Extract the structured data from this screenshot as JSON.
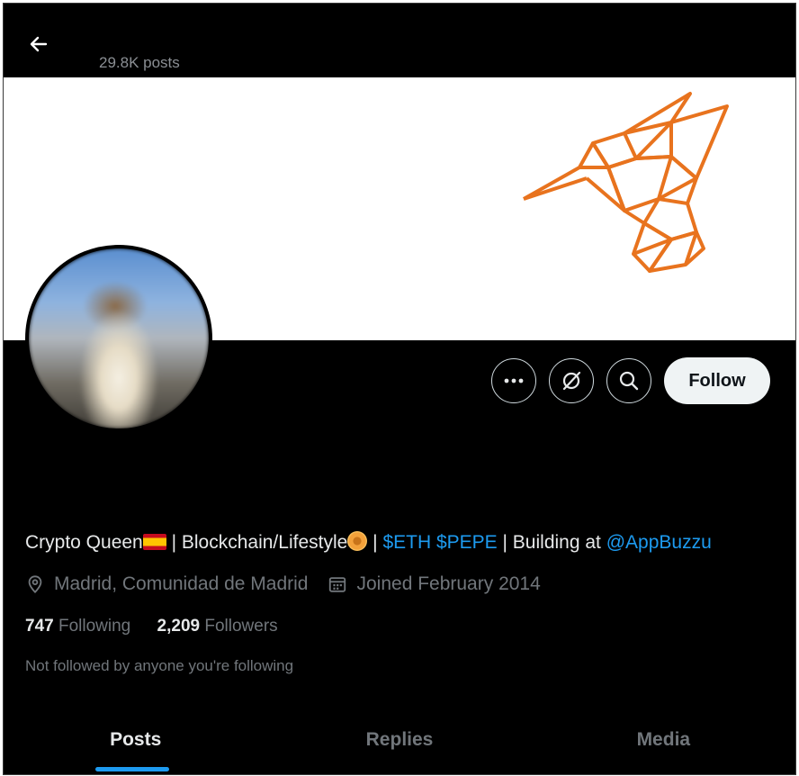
{
  "header": {
    "posts_count": "29.8K posts"
  },
  "profile": {
    "bio": {
      "part1": "Crypto Queen",
      "part2": " | Blockchain/Lifestyle",
      "part3": " | ",
      "tickers": "$ETH $PEPE",
      "part4": " | Building at ",
      "mention": "@AppBuzzu"
    },
    "location": "Madrid, Comunidad de Madrid",
    "joined": "Joined February 2014",
    "following_count": "747",
    "following_label": "Following",
    "followers_count": "2,209",
    "followers_label": "Followers",
    "not_followed_text": "Not followed by anyone you're following"
  },
  "actions": {
    "more_icon": "more-horizontal-icon",
    "grok_icon": "grok-icon",
    "search_icon": "search-icon",
    "follow_label": "Follow"
  },
  "tabs": [
    {
      "label": "Posts",
      "active": true
    },
    {
      "label": "Replies",
      "active": false
    },
    {
      "label": "Media",
      "active": false
    }
  ],
  "colors": {
    "background": "#000000",
    "link": "#1d9bf0",
    "muted": "#71767b",
    "banner_accent": "#e8731e"
  }
}
